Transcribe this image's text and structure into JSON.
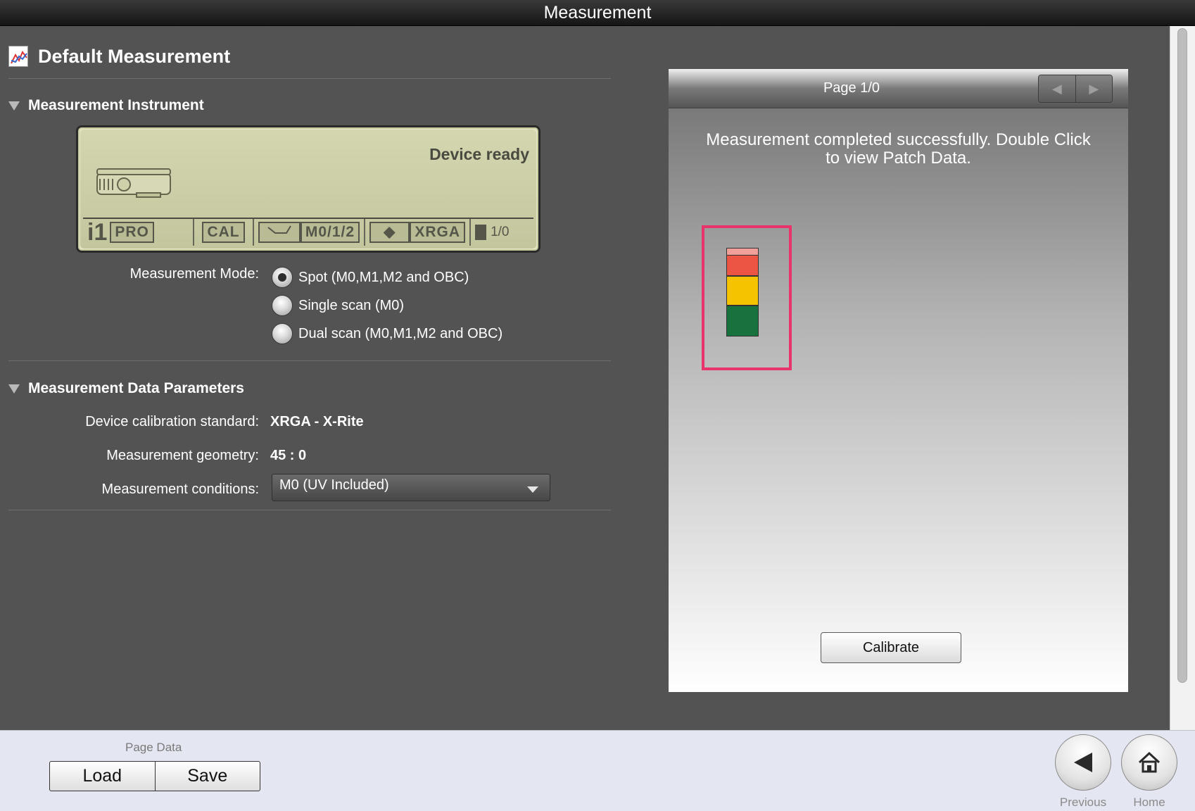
{
  "window": {
    "title": "Measurement"
  },
  "header": {
    "title": "Default Measurement",
    "icon": "chart-document-icon"
  },
  "instrument_section": {
    "title": "Measurement Instrument",
    "lcd": {
      "status": "Device ready",
      "device_icon": "spectrophotometer-icon",
      "brand_i1": "i1",
      "brand_pro": "PRO",
      "cal": "CAL",
      "mode_icon": "scan-arrow-icon",
      "mode": "M0/1/2",
      "target_icon": "target-icon",
      "standard": "XRGA",
      "page_icon": "page-icon",
      "count": "1/0"
    },
    "measurement_mode_label": "Measurement Mode:",
    "modes": [
      {
        "label": "Spot (M0,M1,M2 and OBC)",
        "checked": true
      },
      {
        "label": "Single scan (M0)",
        "checked": false
      },
      {
        "label": "Dual scan (M0,M1,M2 and OBC)",
        "checked": false
      }
    ]
  },
  "parameters_section": {
    "title": "Measurement Data Parameters",
    "calibration_label": "Device calibration standard:",
    "calibration_value": "XRGA - X-Rite",
    "geometry_label": "Measurement geometry:",
    "geometry_value": "45 : 0",
    "conditions_label": "Measurement conditions:",
    "conditions_value": "M0 (UV Included)"
  },
  "patch_panel": {
    "page": "Page 1/0",
    "prev_icon": "arrow-left-icon",
    "next_icon": "arrow-right-icon",
    "message": "Measurement completed successfully. Double Click to view Patch Data.",
    "patches": [
      {
        "color": "#f0a099"
      },
      {
        "color": "#ec5544"
      },
      {
        "color": "#f6c300"
      },
      {
        "color": "#17723d"
      }
    ],
    "highlight_color": "#e8336b",
    "calibrate_label": "Calibrate"
  },
  "footer": {
    "page_data_label": "Page Data",
    "load_label": "Load",
    "save_label": "Save",
    "previous_label": "Previous",
    "home_label": "Home"
  }
}
